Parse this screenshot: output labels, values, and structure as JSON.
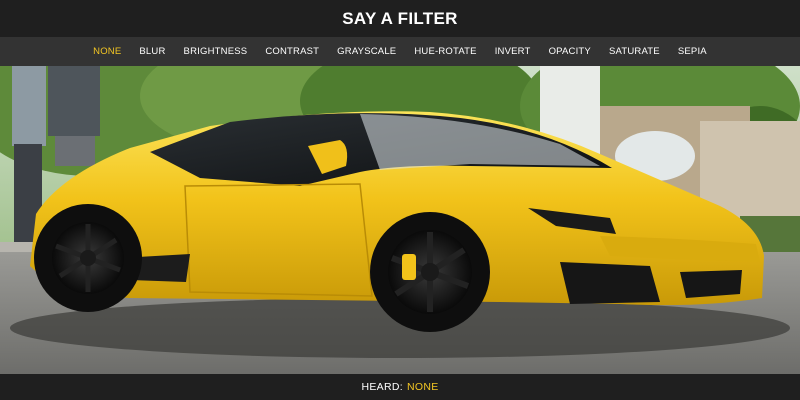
{
  "header": {
    "title": "SAY A FILTER"
  },
  "filters": [
    {
      "label": "NONE",
      "active": true
    },
    {
      "label": "BLUR",
      "active": false
    },
    {
      "label": "BRIGHTNESS",
      "active": false
    },
    {
      "label": "CONTRAST",
      "active": false
    },
    {
      "label": "GRAYSCALE",
      "active": false
    },
    {
      "label": "HUE-ROTATE",
      "active": false
    },
    {
      "label": "INVERT",
      "active": false
    },
    {
      "label": "OPACITY",
      "active": false
    },
    {
      "label": "SATURATE",
      "active": false
    },
    {
      "label": "SEPIA",
      "active": false
    }
  ],
  "footer": {
    "label": "HEARD:",
    "value": "NONE"
  },
  "colors": {
    "accent": "#f3c623",
    "background": "#1f1f1f",
    "bar": "#333333",
    "car_body": "#f2c31a"
  }
}
